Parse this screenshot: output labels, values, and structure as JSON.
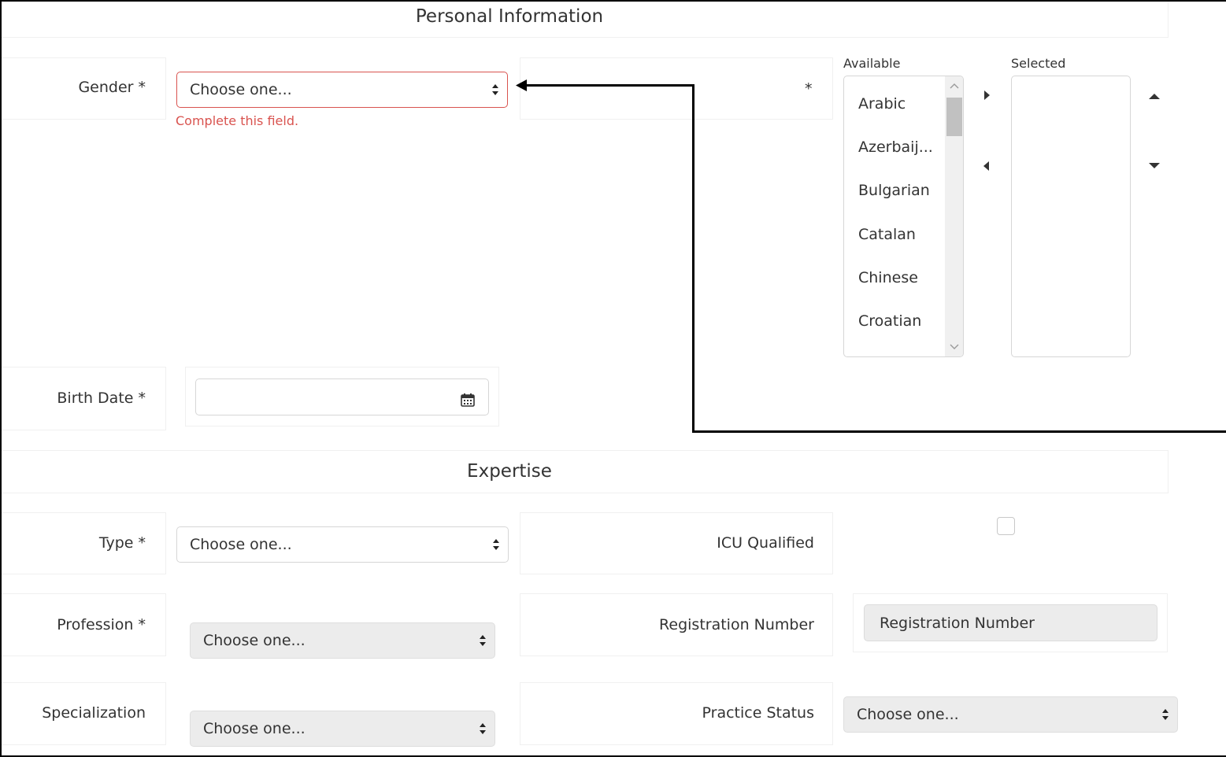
{
  "personal_section": {
    "title": "Personal Information",
    "gender": {
      "label": "Gender *",
      "value": "Choose one...",
      "error": "Complete this field."
    },
    "languages": {
      "label": "*",
      "available_caption": "Available",
      "selected_caption": "Selected",
      "available_items": [
        "Arabic",
        "Azerbaij...",
        "Bulgarian",
        "Catalan",
        "Chinese",
        "Croatian"
      ],
      "selected_items": []
    },
    "birth_date": {
      "label": "Birth Date *",
      "value": ""
    }
  },
  "expertise_section": {
    "title": "Expertise",
    "type": {
      "label": "Type *",
      "value": "Choose one..."
    },
    "icu_qualified": {
      "label": "ICU Qualified",
      "checked": false
    },
    "profession": {
      "label": "Profession *",
      "value": "Choose one..."
    },
    "registration_number": {
      "label": "Registration Number",
      "placeholder": "Registration Number"
    },
    "specialization": {
      "label": "Specialization",
      "value": "Choose one..."
    },
    "practice_status": {
      "label": "Practice Status",
      "value": "Choose one..."
    }
  },
  "colors": {
    "error": "#d9534f",
    "disabled_bg": "#ececec",
    "border": "#d6d6d6"
  }
}
